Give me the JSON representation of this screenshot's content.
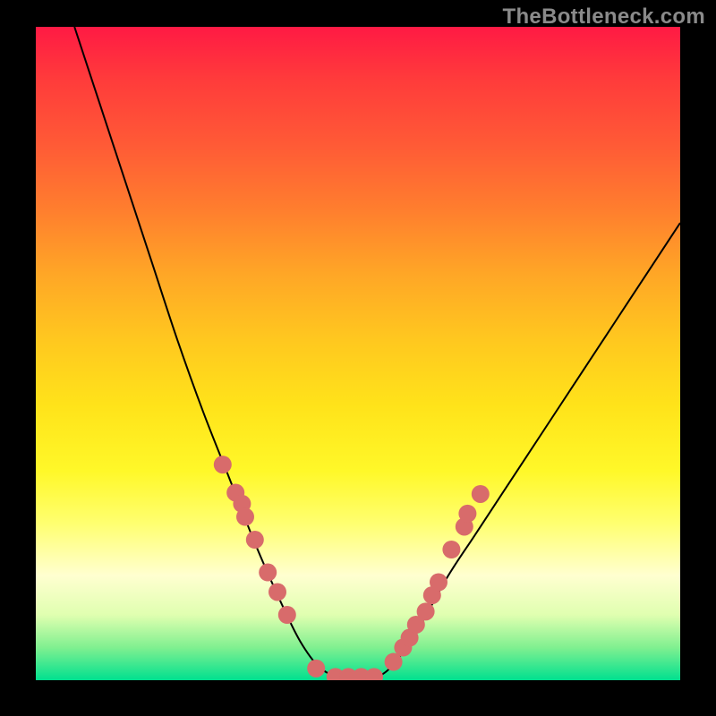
{
  "watermark": "TheBottleneck.com",
  "chart_data": {
    "type": "line",
    "title": "",
    "xlabel": "",
    "ylabel": "",
    "xlim": [
      0,
      1
    ],
    "ylim": [
      0,
      1
    ],
    "curve_left": [
      {
        "x": 0.06,
        "y": 1.0
      },
      {
        "x": 0.1,
        "y": 0.88
      },
      {
        "x": 0.14,
        "y": 0.76
      },
      {
        "x": 0.18,
        "y": 0.64
      },
      {
        "x": 0.22,
        "y": 0.52
      },
      {
        "x": 0.26,
        "y": 0.41
      },
      {
        "x": 0.3,
        "y": 0.31
      },
      {
        "x": 0.34,
        "y": 0.21
      },
      {
        "x": 0.38,
        "y": 0.12
      },
      {
        "x": 0.41,
        "y": 0.06
      },
      {
        "x": 0.44,
        "y": 0.02
      },
      {
        "x": 0.47,
        "y": 0.005
      }
    ],
    "curve_bottom": [
      {
        "x": 0.47,
        "y": 0.005
      },
      {
        "x": 0.5,
        "y": 0.005
      },
      {
        "x": 0.53,
        "y": 0.005
      }
    ],
    "curve_right": [
      {
        "x": 0.53,
        "y": 0.005
      },
      {
        "x": 0.56,
        "y": 0.03
      },
      {
        "x": 0.6,
        "y": 0.09
      },
      {
        "x": 0.64,
        "y": 0.16
      },
      {
        "x": 0.68,
        "y": 0.22
      },
      {
        "x": 0.72,
        "y": 0.28
      },
      {
        "x": 0.76,
        "y": 0.34
      },
      {
        "x": 0.8,
        "y": 0.4
      },
      {
        "x": 0.84,
        "y": 0.46
      },
      {
        "x": 0.88,
        "y": 0.52
      },
      {
        "x": 0.92,
        "y": 0.58
      },
      {
        "x": 0.96,
        "y": 0.64
      },
      {
        "x": 1.0,
        "y": 0.7
      }
    ],
    "markers_left": [
      {
        "x": 0.29,
        "y": 0.33
      },
      {
        "x": 0.31,
        "y": 0.287
      },
      {
        "x": 0.32,
        "y": 0.27
      },
      {
        "x": 0.325,
        "y": 0.25
      },
      {
        "x": 0.34,
        "y": 0.215
      },
      {
        "x": 0.36,
        "y": 0.165
      },
      {
        "x": 0.375,
        "y": 0.135
      },
      {
        "x": 0.39,
        "y": 0.1
      },
      {
        "x": 0.435,
        "y": 0.018
      }
    ],
    "markers_bottom": [
      {
        "x": 0.465,
        "y": 0.005
      },
      {
        "x": 0.485,
        "y": 0.005
      },
      {
        "x": 0.505,
        "y": 0.005
      },
      {
        "x": 0.525,
        "y": 0.005
      }
    ],
    "markers_right": [
      {
        "x": 0.555,
        "y": 0.028
      },
      {
        "x": 0.57,
        "y": 0.05
      },
      {
        "x": 0.58,
        "y": 0.065
      },
      {
        "x": 0.59,
        "y": 0.085
      },
      {
        "x": 0.605,
        "y": 0.105
      },
      {
        "x": 0.615,
        "y": 0.13
      },
      {
        "x": 0.625,
        "y": 0.15
      },
      {
        "x": 0.645,
        "y": 0.2
      },
      {
        "x": 0.665,
        "y": 0.235
      },
      {
        "x": 0.67,
        "y": 0.255
      },
      {
        "x": 0.69,
        "y": 0.285
      }
    ],
    "marker_color": "#d86b6b",
    "marker_radius": 10,
    "curve_color": "#000000",
    "curve_width": 2
  }
}
